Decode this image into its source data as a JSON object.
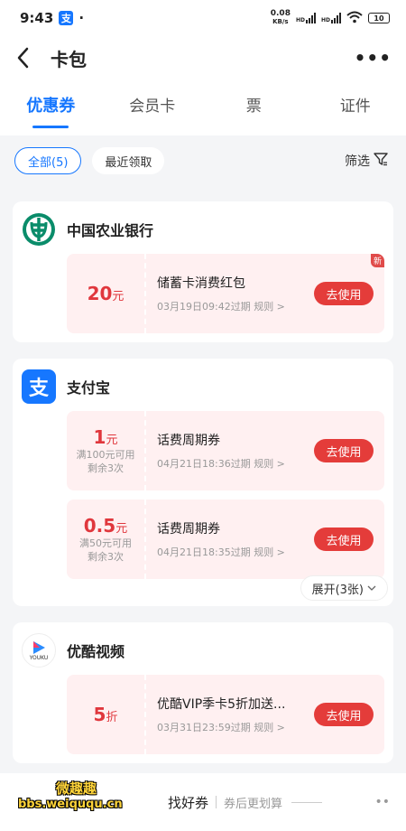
{
  "status": {
    "time": "9:43",
    "alipay_glyph": "支",
    "dot": "·",
    "speed": "0.08",
    "speed_unit": "KB/s",
    "hd1": "HD",
    "hd2": "HD",
    "battery": "10"
  },
  "nav": {
    "title": "卡包",
    "more": "•••"
  },
  "tabs": [
    "优惠券",
    "会员卡",
    "票",
    "证件"
  ],
  "filters": {
    "all": "全部(5)",
    "recent": "最近领取",
    "filter": "筛选"
  },
  "merchants": [
    {
      "name": "中国农业银行",
      "coupons": [
        {
          "amount": "20",
          "unit": "元",
          "title": "储蓄卡消费红包",
          "meta": "03月19日09:42过期  规则 >",
          "button": "去使用",
          "badge": "新"
        }
      ]
    },
    {
      "name": "支付宝",
      "logo_glyph": "支",
      "coupons": [
        {
          "amount": "1",
          "unit": "元",
          "line1": "满100元可用",
          "line2": "剩余3次",
          "title": "话费周期券",
          "meta": "04月21日18:36过期  规则 >",
          "button": "去使用"
        },
        {
          "amount": "0.5",
          "unit": "元",
          "line1": "满50元可用",
          "line2": "剩余3次",
          "title": "话费周期券",
          "meta": "04月21日18:35过期  规则 >",
          "button": "去使用"
        }
      ],
      "expand": "展开(3张)"
    },
    {
      "name": "优酷视频",
      "logo_text": "YOUKU",
      "coupons": [
        {
          "amount": "5",
          "unit": "折",
          "title": "优酷VIP季卡5折加送...",
          "meta": "03月31日23:59过期  规则 >",
          "button": "去使用"
        }
      ]
    }
  ],
  "bottom": {
    "title": "找好券",
    "sub": "券后更划算"
  },
  "watermark": {
    "line1": "微趣趣",
    "line2": "bbs.weiququ.cn"
  },
  "colors": {
    "accent": "#1677ff",
    "coupon_bg": "#fff0f1",
    "red": "#e43c3a"
  }
}
